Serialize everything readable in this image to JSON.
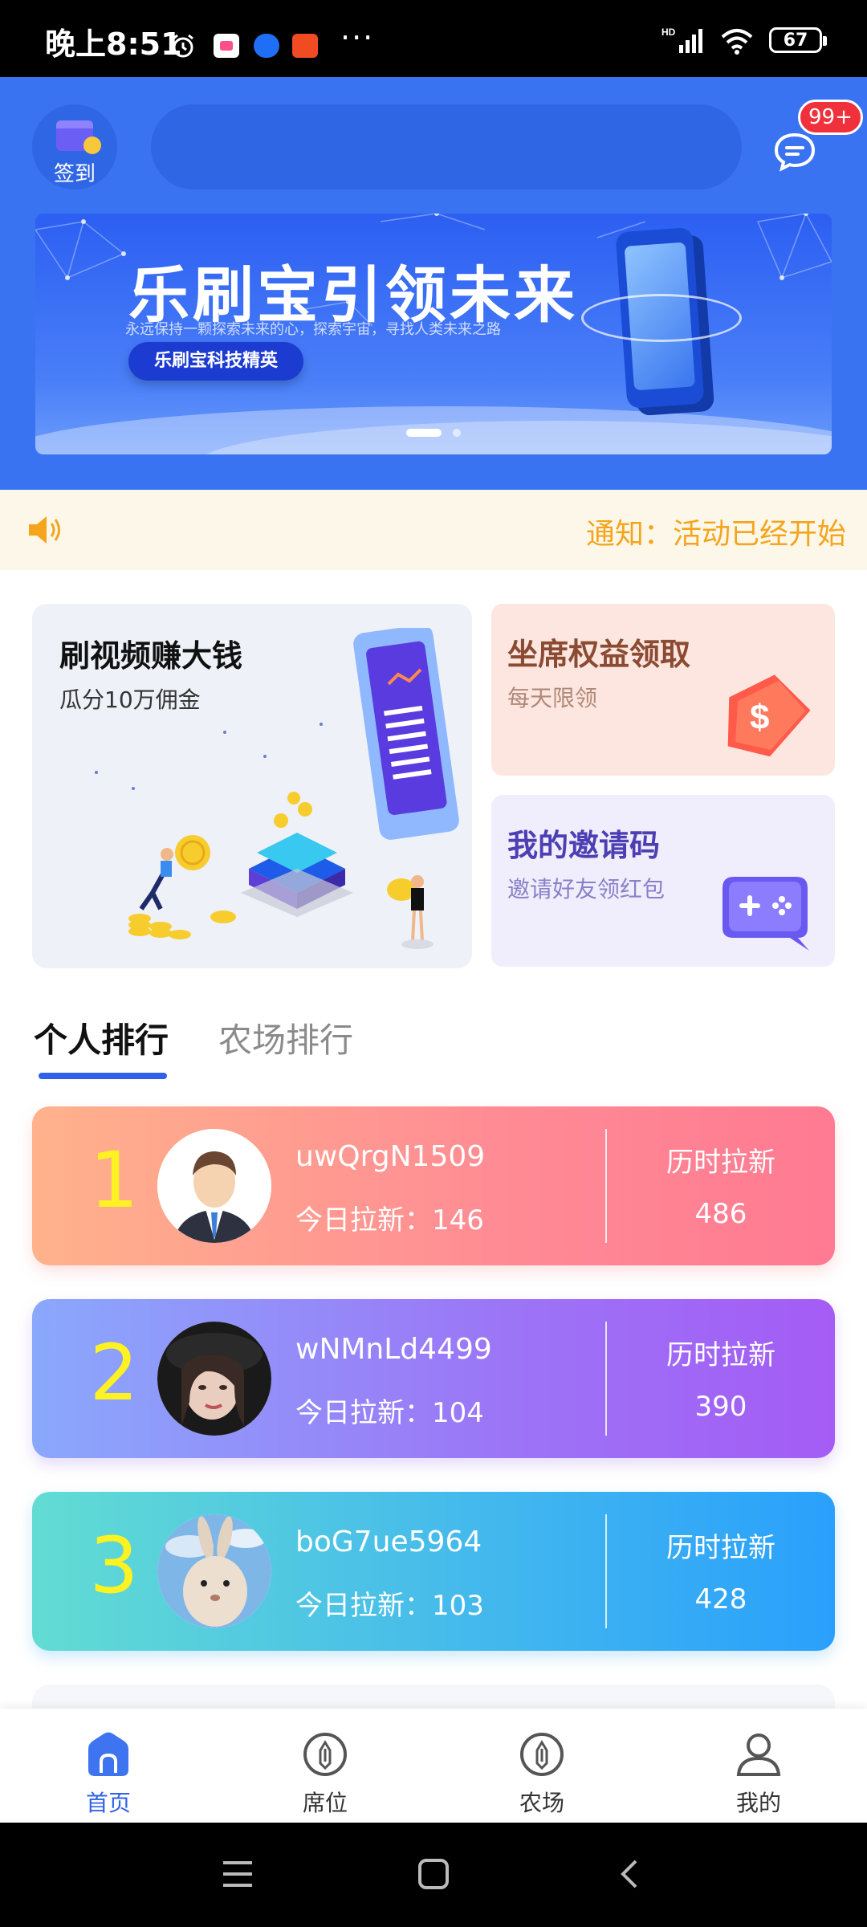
{
  "status_bar": {
    "time": "晚上8:51",
    "more": "···",
    "network": "HD",
    "battery": "67",
    "app_icons": [
      "alarm-icon",
      "app-icon-photos",
      "app-icon-bird",
      "app-icon-taobao"
    ]
  },
  "header": {
    "signin_label": "签到",
    "message_badge": "99+"
  },
  "banner": {
    "title": "乐刷宝引领未来",
    "subtitle": "永远保持一颗探索未来的心，探索宇宙，寻找人类未来之路",
    "pill": "乐刷宝科技精英"
  },
  "notice": {
    "text": "通知：活动已经开始"
  },
  "cards": {
    "video": {
      "title": "刷视频赚大钱",
      "subtitle": "瓜分10万佣金"
    },
    "seat": {
      "title": "坐席权益领取",
      "subtitle": "每天限领"
    },
    "invite": {
      "title": "我的邀请码",
      "subtitle": "邀请好友领红包"
    }
  },
  "tabs": [
    {
      "label": "个人排行",
      "active": true
    },
    {
      "label": "农场排行",
      "active": false
    }
  ],
  "rankings": [
    {
      "rank": "1",
      "name": "uwQrgN1509",
      "today": "今日拉新：146",
      "total_label": "历时拉新",
      "total": "486"
    },
    {
      "rank": "2",
      "name": "wNMnLd4499",
      "today": "今日拉新：104",
      "total_label": "历时拉新",
      "total": "390"
    },
    {
      "rank": "3",
      "name": "boG7ue5964",
      "today": "今日拉新：103",
      "total_label": "历时拉新",
      "total": "428"
    }
  ],
  "bottom_nav": [
    {
      "label": "首页",
      "icon": "home-icon",
      "active": true
    },
    {
      "label": "席位",
      "icon": "seat-icon",
      "active": false
    },
    {
      "label": "农场",
      "icon": "farm-icon",
      "active": false
    },
    {
      "label": "我的",
      "icon": "profile-icon",
      "active": false
    }
  ],
  "colors": {
    "header_blue": "#3a73f2",
    "accent": "#2f62e8",
    "notice_orange": "#f4a51c",
    "rank_number_yellow": "#fff222"
  }
}
